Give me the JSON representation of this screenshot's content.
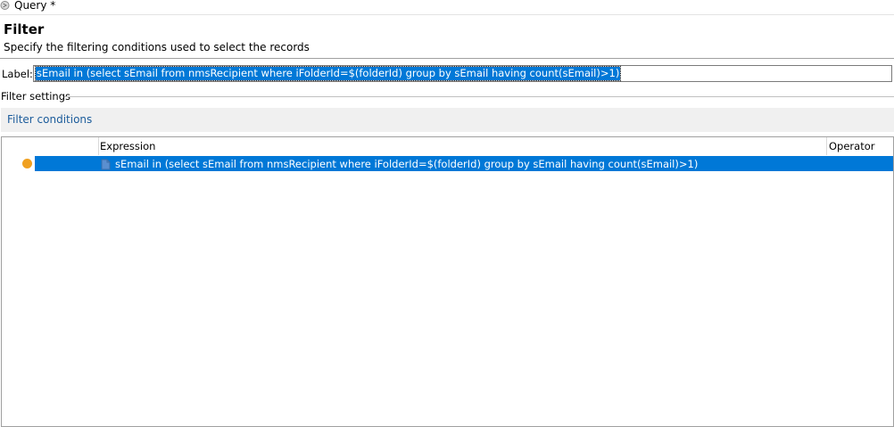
{
  "window": {
    "title": "Query *",
    "icon": "query-icon"
  },
  "header": {
    "title": "Filter",
    "subtitle": "Specify the filtering conditions used to select the records"
  },
  "label_field": {
    "label": "Label:",
    "value": "sEmail in (select sEmail from nmsRecipient where iFolderId=$(folderId) group by sEmail having count(sEmail)>1)"
  },
  "filter_settings": {
    "legend": "Filter settings",
    "tab_label": "Filter conditions"
  },
  "conditions_table": {
    "columns": [
      "Expression",
      "Operator"
    ],
    "rows": [
      {
        "status_icon": "orange-dot-icon",
        "icon": "condition-icon",
        "expression": "sEmail in (select sEmail from nmsRecipient where iFolderId=$(folderId) group by sEmail having count(sEmail)>1)",
        "operator": "",
        "selected": true
      }
    ]
  },
  "colors": {
    "selection": "#0078d7",
    "status_dot": "#f0a020",
    "link": "#1c5c9b"
  }
}
